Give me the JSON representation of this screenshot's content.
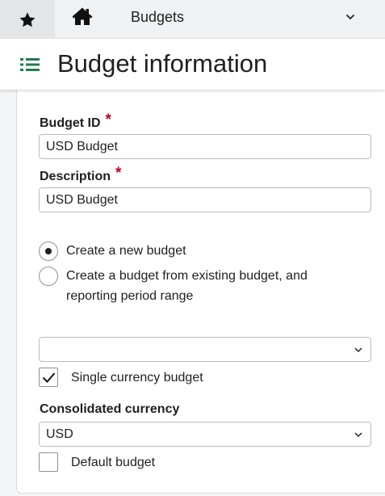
{
  "topbar": {
    "title": "Budgets"
  },
  "header": {
    "title": "Budget information"
  },
  "form": {
    "budget_id": {
      "label": "Budget ID",
      "required_mark": "*",
      "value": "USD Budget"
    },
    "description": {
      "label": "Description",
      "required_mark": "*",
      "value": "USD Budget"
    },
    "creation_mode": {
      "options": [
        {
          "label": "Create a new budget",
          "selected": true
        },
        {
          "label": "Create a budget from existing budget, and",
          "label_line2": "reporting period range",
          "selected": false
        }
      ]
    },
    "existing_budget_select": {
      "value": ""
    },
    "single_currency": {
      "label": "Single currency budget",
      "checked": true
    },
    "consolidated_currency": {
      "label": "Consolidated currency",
      "value": "USD"
    },
    "default_budget": {
      "label": "Default budget",
      "checked": false
    }
  },
  "colors": {
    "accent_green": "#1f7a4d",
    "required_red": "#c0001d"
  },
  "icons": {
    "favorites": "star-icon",
    "home": "home-icon",
    "menu": "list-icon",
    "dropdown": "chevron-down-icon",
    "check": "checkmark-icon"
  }
}
